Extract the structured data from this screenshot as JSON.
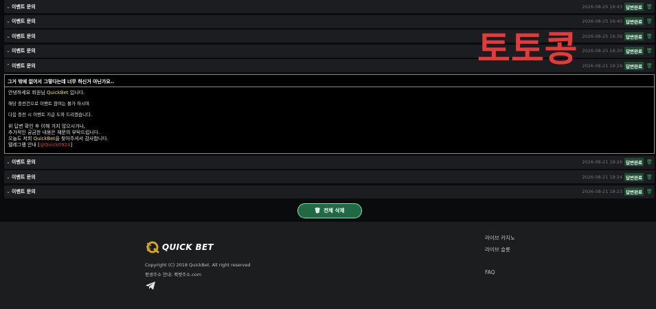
{
  "inquiries_before": [
    {
      "title": "이벤트 문의",
      "date": "2026-08-25 16:43",
      "status": "답변완료"
    },
    {
      "title": "이벤트 문의",
      "date": "2026-08-25 16:40",
      "status": "답변완료"
    },
    {
      "title": "이벤트 문의",
      "date": "2026-08-25 16:36",
      "status": "답변완료"
    },
    {
      "title": "이벤트 문의",
      "date": "2026-08-25 16:30",
      "status": "답변완료"
    },
    {
      "title": "이벤트 문의",
      "date": "2026-08-21 18:28",
      "status": "답변완료"
    }
  ],
  "expanded": {
    "question": "그거 밖에 없어서 그렇다는데 너무 하신거 아닌가요..",
    "greeting_pre": "안녕하세요 회원님 ",
    "brand": "QuickBet",
    "greeting_post": " 입니다.",
    "line1": "해당 충전건으로 이벤트 참여는 불가 하시며",
    "line2": "다음 충전 시 이벤트 지급 도와 드리겠습니다.",
    "line3": "위 답변 확인 후 이해 가지 않으시거나,",
    "line4": "추가적인 궁금한 내용은 재문의 부탁드립니다.",
    "line5_pre": "오늘도 저희 ",
    "line5_brand": "QuickBet",
    "line5_post": "을 찾아주셔서 감사합니다.",
    "telegram_pre": "텔레그램 안내 [",
    "telegram_handle": "@Quick0924",
    "telegram_post": "]"
  },
  "inquiries_after": [
    {
      "title": "이벤트 문의",
      "date": "2026-08-21 18:26",
      "status": "답변완료"
    },
    {
      "title": "이벤트 문의",
      "date": "2026-08-21 18:24",
      "status": "답변완료"
    },
    {
      "title": "이벤트 문의",
      "date": "2026-08-21 18:23",
      "status": "답변완료"
    }
  ],
  "delete_all_label": "전체 삭제",
  "footer": {
    "logo_text": "QUICK BET",
    "copyright": "Copyright (C) 2018 QuickBet. All right reserved",
    "address": "평생주소 안내: 퀵벳주소.com",
    "links": [
      "라이브 카지노",
      "라이브 슬롯",
      "",
      "FAQ"
    ]
  },
  "watermark": "토토콩",
  "icons": {
    "collapsed_chevron": "chevron-down-icon",
    "expanded_chevron": "chevron-up-icon",
    "trash": "trash-icon",
    "telegram": "telegram-icon"
  },
  "colors": {
    "badge_bg": "#1f4a34",
    "button_bg": "#1f6a45",
    "brand_yellow": "#f4e04d",
    "accent_red": "#e53935"
  }
}
